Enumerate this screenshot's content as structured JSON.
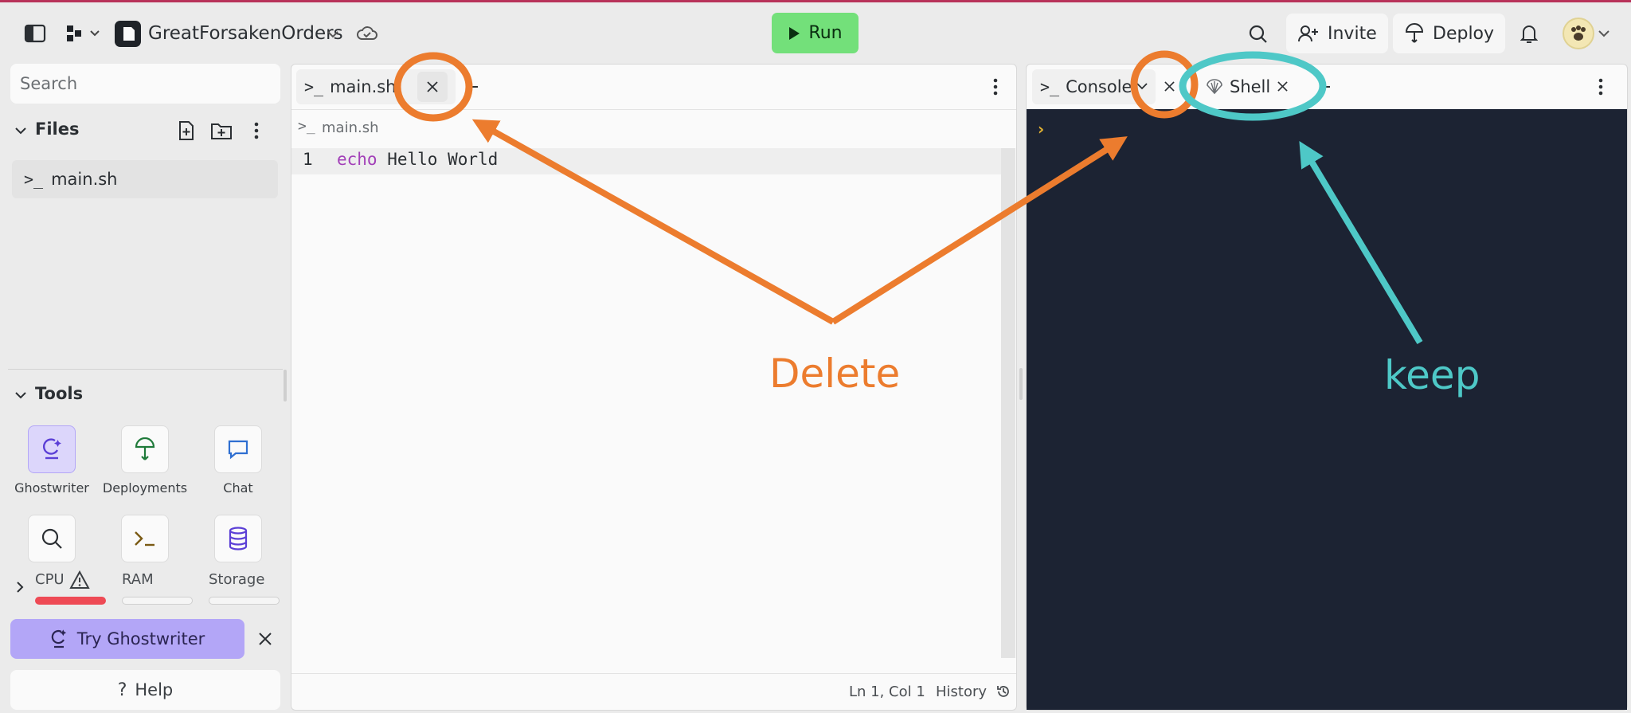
{
  "topbar": {
    "repo_name": "GreatForsakenOrders",
    "run_label": "Run",
    "invite_label": "Invite",
    "deploy_label": "Deploy"
  },
  "sidebar": {
    "search_placeholder": "Search",
    "files_title": "Files",
    "files": [
      {
        "name": "main.sh"
      }
    ],
    "tools_title": "Tools",
    "tools": [
      {
        "label": "Ghostwriter"
      },
      {
        "label": "Deployments"
      },
      {
        "label": "Chat"
      }
    ],
    "resources": {
      "cpu_label": "CPU",
      "ram_label": "RAM",
      "storage_label": "Storage"
    },
    "try_label": "Try Ghostwriter",
    "help_label": "Help"
  },
  "editor": {
    "tab_label": "main.sh",
    "breadcrumb": "main.sh",
    "line_number": "1",
    "code_keyword": "echo",
    "code_rest": " Hello World",
    "status_position": "Ln 1, Col 1",
    "history_label": "History"
  },
  "console": {
    "tab_console": "Console",
    "tab_shell": "Shell",
    "prompt": "›"
  },
  "annotations": {
    "delete_label": "Delete",
    "keep_label": "keep",
    "delete_color": "#ec7c2e",
    "keep_color": "#4ec8c7"
  },
  "colors": {
    "accent_bar": "#b8325a",
    "run_green": "#73e07a",
    "ghostwriter_purple": "#b3a6f7",
    "terminal_bg": "#1c2333"
  }
}
